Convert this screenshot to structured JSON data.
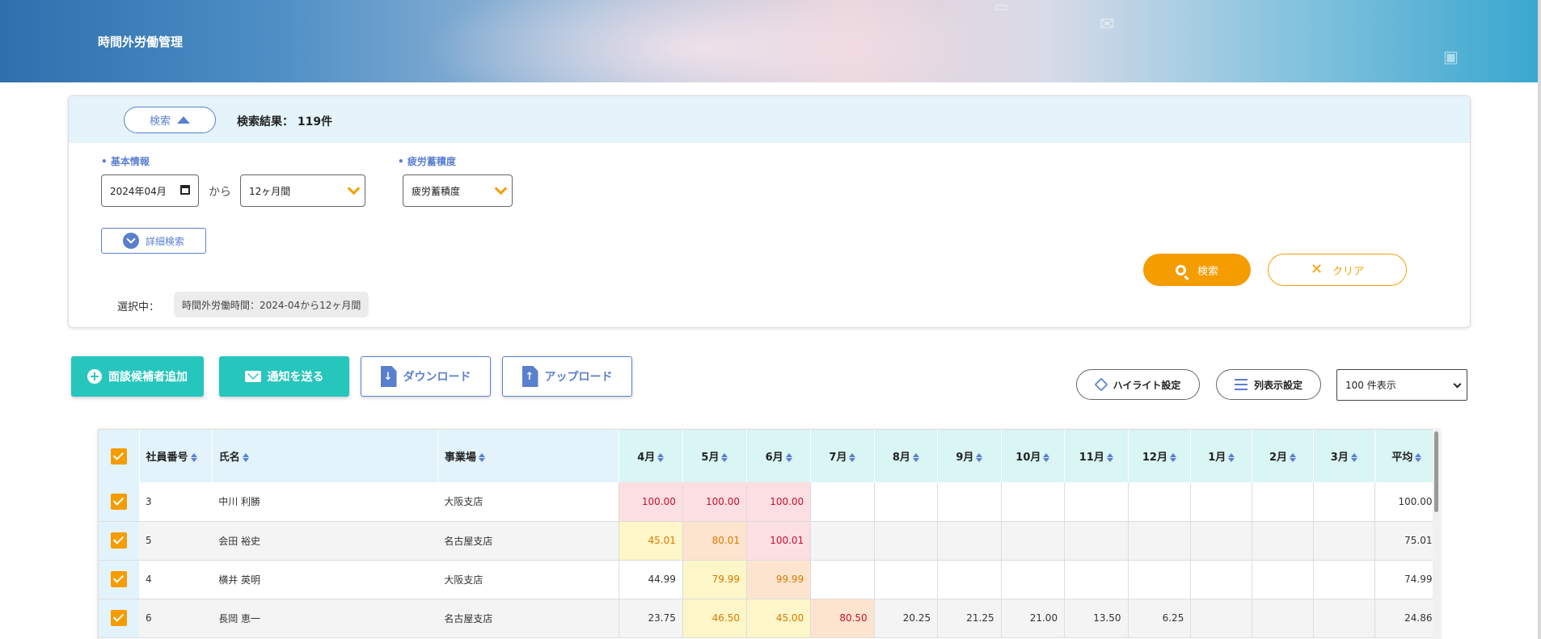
{
  "header": {
    "title": "時間外労働管理"
  },
  "search": {
    "toggle_label": "検索",
    "result_text": "検索結果： 119件",
    "basic_label": "• 基本情報",
    "fatigue_label": "• 疲労蓄積度",
    "start_month": "2024年04月",
    "from_text": "から",
    "period_value": "12ヶ月間",
    "fatigue_value": "疲労蓄積度",
    "advanced_label": "詳細検索",
    "selected_label": "選択中：",
    "selected_chip": "時間外労働時間：2024-04から12ヶ月間",
    "search_button": "検索",
    "clear_button": "クリア"
  },
  "actions": {
    "add_candidate": "面談候補者追加",
    "send_notice": "通知を送る",
    "download": "ダウンロード",
    "upload": "アップロード",
    "highlight": "ハイライト設定",
    "columns": "列表示設定",
    "page_size": "100 件表示"
  },
  "table": {
    "headers": {
      "id": "社員番号",
      "name": "氏名",
      "office": "事業場",
      "months": [
        "4月",
        "5月",
        "6月",
        "7月",
        "8月",
        "9月",
        "10月",
        "11月",
        "12月",
        "1月",
        "2月",
        "3月"
      ],
      "avg": "平均"
    },
    "rows": [
      {
        "id": "3",
        "name": "中川 利勝",
        "office": "大阪支店",
        "values": [
          "100.00",
          "100.00",
          "100.00",
          "",
          "",
          "",
          "",
          "",
          "",
          "",
          "",
          ""
        ],
        "avg": "100.00"
      },
      {
        "id": "5",
        "name": "会田 裕史",
        "office": "名古屋支店",
        "values": [
          "45.01",
          "80.01",
          "100.01",
          "",
          "",
          "",
          "",
          "",
          "",
          "",
          "",
          ""
        ],
        "avg": "75.01"
      },
      {
        "id": "4",
        "name": "横井 英明",
        "office": "大阪支店",
        "values": [
          "44.99",
          "79.99",
          "99.99",
          "",
          "",
          "",
          "",
          "",
          "",
          "",
          "",
          ""
        ],
        "avg": "74.99"
      },
      {
        "id": "6",
        "name": "長岡 恵一",
        "office": "名古屋支店",
        "values": [
          "23.75",
          "46.50",
          "45.00",
          "80.50",
          "20.25",
          "21.25",
          "21.00",
          "13.50",
          "6.25",
          "",
          "",
          ""
        ],
        "avg": "24.86"
      }
    ]
  }
}
